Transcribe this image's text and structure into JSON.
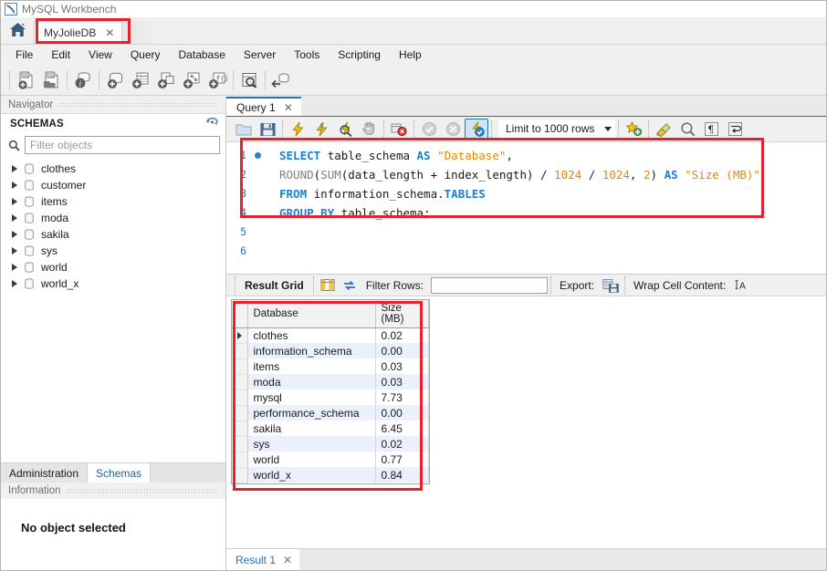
{
  "window": {
    "title": "MySQL Workbench",
    "icon": "workbench-logo-icon"
  },
  "tabstrip": {
    "home_icon": "home-icon",
    "connection_tab": {
      "label": "MyJolieDB",
      "close": "✕"
    }
  },
  "menubar": {
    "items": [
      {
        "label": "File"
      },
      {
        "label": "Edit"
      },
      {
        "label": "View"
      },
      {
        "label": "Query"
      },
      {
        "label": "Database"
      },
      {
        "label": "Server"
      },
      {
        "label": "Tools"
      },
      {
        "label": "Scripting"
      },
      {
        "label": "Help"
      }
    ]
  },
  "main_toolbar": {
    "items": [
      {
        "name": "new-sql-tab-icon",
        "title": "Create a new SQL tab for executing queries"
      },
      {
        "name": "open-sql-script-icon",
        "title": "Open a SQL script file in a new query tab"
      },
      {
        "name": "server-status-icon",
        "title": "Open Inspector for the selected object"
      },
      {
        "name": "new-schema-icon",
        "title": "Create a new schema in the connected server"
      },
      {
        "name": "new-table-icon",
        "title": "Create a new table in the active schema"
      },
      {
        "name": "new-view-icon",
        "title": "Create a new view in the active schema"
      },
      {
        "name": "new-procedure-icon",
        "title": "Create a new stored procedure in the active schema"
      },
      {
        "name": "new-function-icon",
        "title": "Create a new function in the active schema"
      },
      {
        "name": "search-data-icon",
        "title": "Search table data for text in objects"
      },
      {
        "name": "reconnect-dbms-icon",
        "title": "Reconnect to DBMS"
      }
    ]
  },
  "sidebar": {
    "navigator_label": "Navigator",
    "schemas_header": "SCHEMAS",
    "refresh_icon": "refresh-icon",
    "search_icon": "search-icon",
    "filter_placeholder": "Filter objects",
    "filter_value": "",
    "schemas": [
      {
        "name": "clothes"
      },
      {
        "name": "customer"
      },
      {
        "name": "items"
      },
      {
        "name": "moda"
      },
      {
        "name": "sakila"
      },
      {
        "name": "sys"
      },
      {
        "name": "world"
      },
      {
        "name": "world_x"
      }
    ],
    "bottom_tabs": [
      {
        "label": "Administration",
        "active": false
      },
      {
        "label": "Schemas",
        "active": true
      }
    ],
    "information_label": "Information",
    "information_text": "No object selected"
  },
  "query": {
    "tab_label": "Query 1",
    "tab_close": "✕",
    "toolbar": {
      "items": [
        {
          "name": "open-script-icon"
        },
        {
          "name": "save-script-icon"
        },
        {
          "name": "execute-statement-icon"
        },
        {
          "name": "execute-current-statement-icon"
        },
        {
          "name": "explain-statement-icon"
        },
        {
          "name": "stop-execution-icon"
        },
        {
          "name": "toggle-stop-on-error-icon"
        },
        {
          "name": "commit-transaction-icon"
        },
        {
          "name": "rollback-transaction-icon"
        },
        {
          "name": "toggle-autocommit-icon"
        }
      ],
      "limit_label": "Limit to 1000 rows",
      "limit_dropdown_icon": "chevron-down-icon",
      "right_items": [
        {
          "name": "add-snippet-icon"
        },
        {
          "name": "beautify-sql-icon"
        },
        {
          "name": "find-icon"
        },
        {
          "name": "toggle-invisible-chars-icon"
        },
        {
          "name": "toggle-wrapping-icon"
        }
      ]
    },
    "line_numbers": [
      "1",
      "2",
      "3",
      "4",
      "5",
      "6"
    ],
    "breakpoint_line": 1,
    "sql_lines": [
      [
        {
          "t": "SELECT ",
          "c": "kw"
        },
        {
          "t": "table_schema ",
          "c": "pln"
        },
        {
          "t": "AS ",
          "c": "kw"
        },
        {
          "t": "\"Database\"",
          "c": "str"
        },
        {
          "t": ",",
          "c": "op"
        }
      ],
      [
        {
          "t": "ROUND",
          "c": "fn"
        },
        {
          "t": "(",
          "c": "op"
        },
        {
          "t": "SUM",
          "c": "fn"
        },
        {
          "t": "(",
          "c": "op"
        },
        {
          "t": "data_length ",
          "c": "pln"
        },
        {
          "t": "+ ",
          "c": "op"
        },
        {
          "t": "index_length",
          "c": "pln"
        },
        {
          "t": ") ",
          "c": "op"
        },
        {
          "t": "/ ",
          "c": "op"
        },
        {
          "t": "1024 ",
          "c": "num"
        },
        {
          "t": "/ ",
          "c": "op"
        },
        {
          "t": "1024",
          "c": "num"
        },
        {
          "t": ", ",
          "c": "op"
        },
        {
          "t": "2",
          "c": "num"
        },
        {
          "t": ") ",
          "c": "op"
        },
        {
          "t": "AS ",
          "c": "kw"
        },
        {
          "t": "\"Size (MB)\"",
          "c": "str"
        }
      ],
      [
        {
          "t": "FROM ",
          "c": "kw"
        },
        {
          "t": "information_schema.",
          "c": "pln"
        },
        {
          "t": "TABLES",
          "c": "kw"
        }
      ],
      [
        {
          "t": "GROUP ",
          "c": "kw"
        },
        {
          "t": "BY ",
          "c": "kw"
        },
        {
          "t": "table_schema;",
          "c": "pln"
        }
      ],
      [],
      []
    ]
  },
  "result_toolbar": {
    "result_grid_label": "Result Grid",
    "grid_view_icon": "grid-view-icon",
    "refresh_icon": "refresh-arrows-icon",
    "filter_rows_label": "Filter Rows:",
    "filter_rows_value": "",
    "export_label": "Export:",
    "export_icon": "export-recordset-icon",
    "wrap_cell_label": "Wrap Cell Content:",
    "wrap_cell_icon": "wrap-cell-icon"
  },
  "result_grid": {
    "columns": [
      "Database",
      "Size\n(MB)"
    ],
    "column_headers": [
      {
        "line1": "Database",
        "line2": ""
      },
      {
        "line1": "Size",
        "line2": "(MB)"
      }
    ],
    "rows": [
      {
        "database": "clothes",
        "size": "0.02",
        "selected": true
      },
      {
        "database": "information_schema",
        "size": "0.00",
        "selected": false
      },
      {
        "database": "items",
        "size": "0.03",
        "selected": false
      },
      {
        "database": "moda",
        "size": "0.03",
        "selected": false
      },
      {
        "database": "mysql",
        "size": "7.73",
        "selected": false
      },
      {
        "database": "performance_schema",
        "size": "0.00",
        "selected": false
      },
      {
        "database": "sakila",
        "size": "6.45",
        "selected": false
      },
      {
        "database": "sys",
        "size": "0.02",
        "selected": false
      },
      {
        "database": "world",
        "size": "0.77",
        "selected": false
      },
      {
        "database": "world_x",
        "size": "0.84",
        "selected": false
      }
    ]
  },
  "result_tabs": [
    {
      "label": "Result 1",
      "close": "✕",
      "active": true
    }
  ],
  "annotations": {
    "highlight_color": "#e8212a",
    "boxes": [
      {
        "name": "connection-tab-highlight"
      },
      {
        "name": "sql-editor-highlight"
      },
      {
        "name": "result-grid-highlight"
      }
    ]
  },
  "colors": {
    "accent_blue": "#2a6faf",
    "keyword_blue": "#1a7fd4",
    "string_orange": "#e08a00",
    "highlight_red": "#e8212a",
    "alt_row": "#eaf1fb"
  }
}
